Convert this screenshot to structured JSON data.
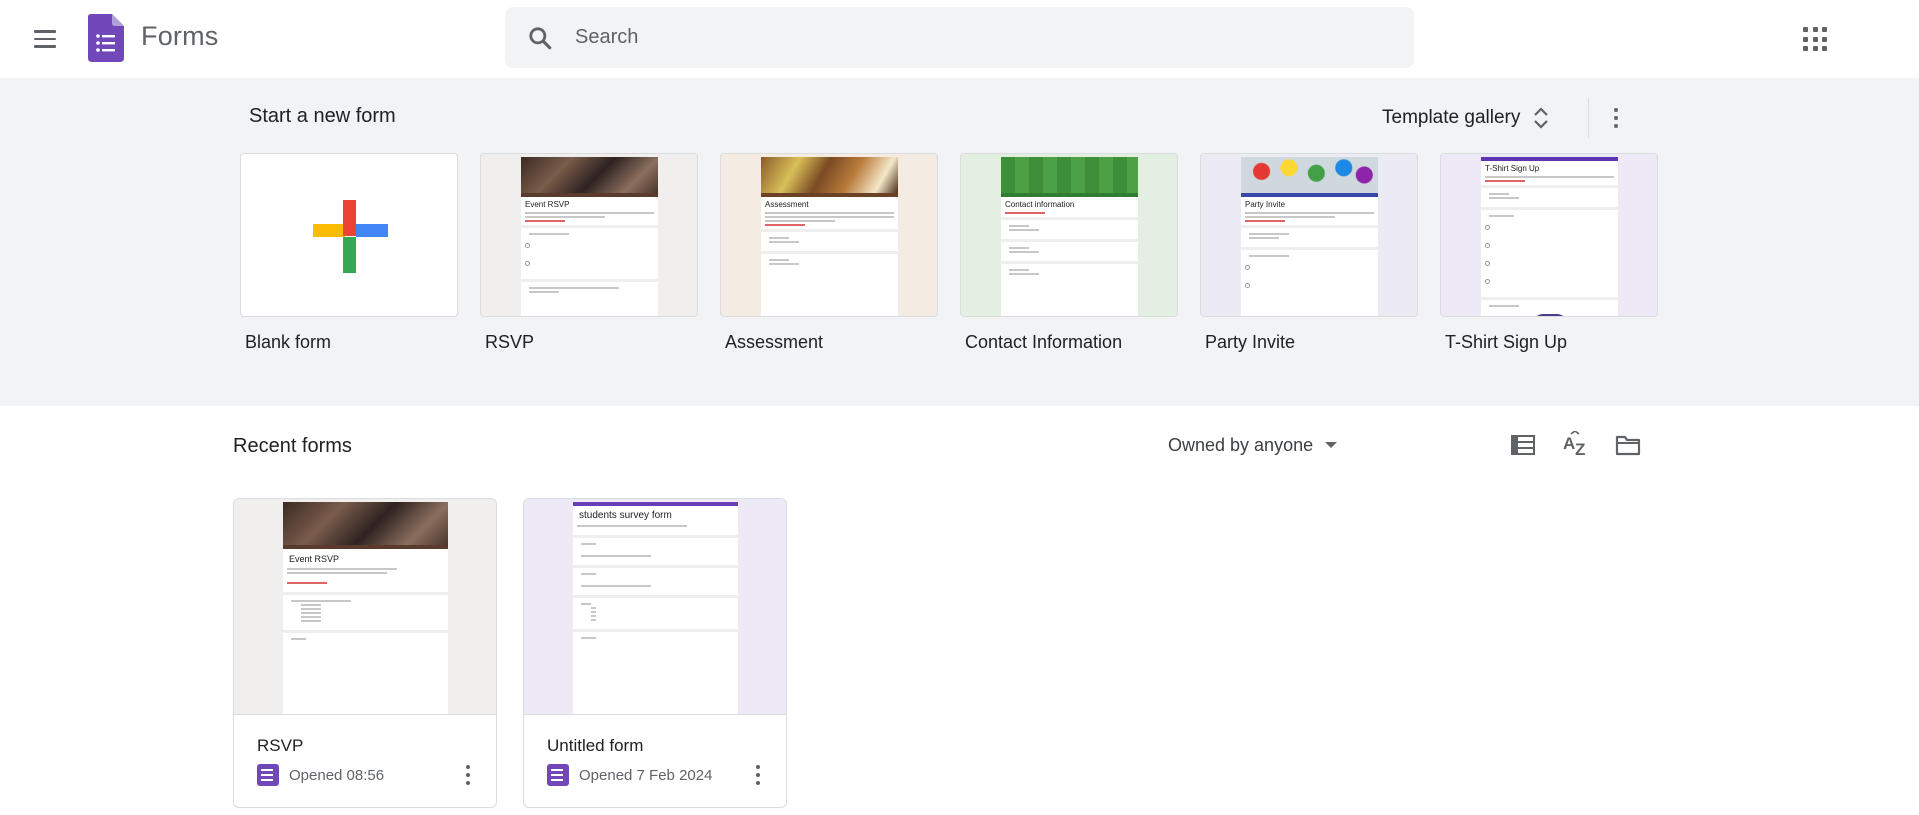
{
  "header": {
    "title": "Forms",
    "search_placeholder": "Search"
  },
  "start": {
    "title": "Start a new form",
    "gallery_label": "Template gallery",
    "templates": [
      {
        "label": "Blank form"
      },
      {
        "label": "RSVP",
        "preview_title": "Event RSVP",
        "accent": "#5a3b2e"
      },
      {
        "label": "Assessment",
        "preview_title": "Assessment",
        "accent": "#6b4226"
      },
      {
        "label": "Contact Information",
        "preview_title": "Contact information",
        "accent": "#2e7d32"
      },
      {
        "label": "Party Invite",
        "preview_title": "Party Invite",
        "accent": "#3949ab"
      },
      {
        "label": "T-Shirt Sign Up",
        "preview_title": "T-Shirt Sign Up",
        "accent": "#5e35b1"
      }
    ]
  },
  "recent": {
    "title": "Recent forms",
    "owner_filter": "Owned by anyone",
    "forms": [
      {
        "name": "RSVP",
        "opened": "Opened 08:56",
        "preview_title": "Event RSVP"
      },
      {
        "name": "Untitled form",
        "opened": "Opened 7 Feb 2024",
        "preview_title": "students survey form"
      }
    ]
  },
  "colors": {
    "forms_purple": "#7248b9",
    "section_bg": "#f1f3f4",
    "plus_red": "#ea4335",
    "plus_blue": "#4285f4",
    "plus_yellow": "#fbbc04",
    "plus_green": "#34a853"
  }
}
